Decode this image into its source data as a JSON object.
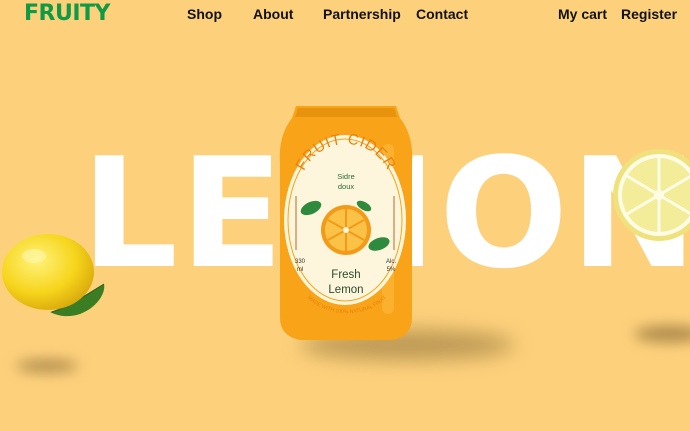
{
  "brand": {
    "logo": "FRUITY",
    "color": "#0F9A45"
  },
  "nav": {
    "links": [
      "Shop",
      "About",
      "Partnership",
      "Contact"
    ],
    "cart": "My cart",
    "register": "Register"
  },
  "hero": {
    "word": "LEMON",
    "background": "#FDD17C"
  },
  "product": {
    "brand": "FRUIT CIDER",
    "subtitle_line1": "Sidre",
    "subtitle_line2": "doux",
    "volume_value": "330",
    "volume_unit": "ml",
    "alcohol_label": "Alc.",
    "alcohol_value": "5%",
    "flavor_line1": "Fresh",
    "flavor_line2": "Lemon",
    "tagline": "MADE WITH 100% NATURAL FRUIT",
    "can_color": "#F8A318",
    "label_color": "#FEF6DC"
  }
}
